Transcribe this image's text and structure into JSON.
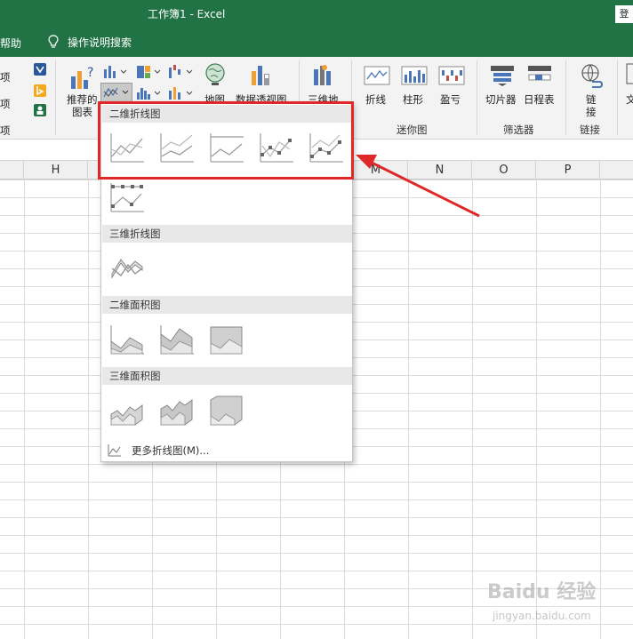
{
  "window": {
    "title": "工作簿1  -  Excel",
    "signin_label": "登"
  },
  "menu": {
    "help": "帮助",
    "tell_me": "操作说明搜索"
  },
  "ribbon": {
    "left_cut": [
      "项",
      "项",
      "项"
    ],
    "recommended_charts": "推荐的\n图表",
    "recommended_line1": "推荐的",
    "recommended_line2": "图表",
    "maps": "地图",
    "pivot_chart": "数据透视图",
    "threed_map": "三维地",
    "sparkline_line": "折线",
    "sparkline_column": "柱形",
    "sparkline_winloss": "盈亏",
    "sparklines_group": "迷你图",
    "slicer": "切片器",
    "timeline": "日程表",
    "filters_group": "筛选器",
    "link_line1": "链",
    "link_line2": "接",
    "links_group": "链接",
    "text_cut": "文"
  },
  "columns": [
    "H",
    "M",
    "N",
    "O",
    "P"
  ],
  "dropdown": {
    "sections": [
      "二维折线图",
      "三维折线图",
      "二维面积图",
      "三维面积图"
    ],
    "more": "更多折线图(M)..."
  },
  "watermark": {
    "brand": "Baidu 经验",
    "url": "jingyan.baidu.com"
  },
  "colors": {
    "excel_green": "#217346",
    "highlight_red": "#e02828"
  }
}
